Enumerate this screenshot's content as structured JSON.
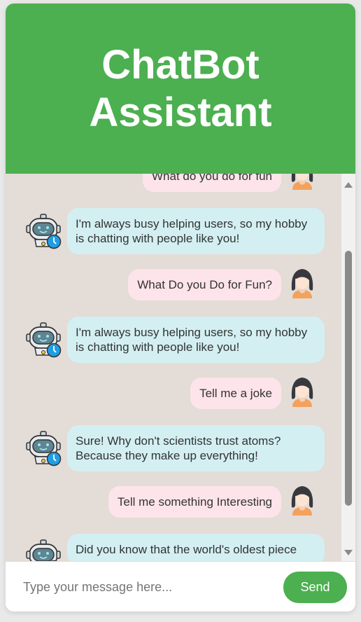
{
  "header": {
    "title": "ChatBot Assistant"
  },
  "messages": [
    {
      "sender": "user",
      "text": "What do you do for fun"
    },
    {
      "sender": "bot",
      "text": "I'm always busy helping users, so my hobby is chatting with people like you!"
    },
    {
      "sender": "user",
      "text": "What Do you Do for Fun?"
    },
    {
      "sender": "bot",
      "text": "I'm always busy helping users, so my hobby is chatting with people like you!"
    },
    {
      "sender": "user",
      "text": "Tell me a joke"
    },
    {
      "sender": "bot",
      "text": "Sure! Why don't scientists trust atoms? Because they make up everything!"
    },
    {
      "sender": "user",
      "text": "Tell me something Interesting"
    },
    {
      "sender": "bot",
      "text": "Did you know that the world's oldest piece"
    }
  ],
  "composer": {
    "placeholder": "Type your message here...",
    "value": "",
    "send_label": "Send"
  },
  "icons": {
    "user_avatar": "woman-avatar-icon",
    "bot_avatar": "robot-avatar-icon",
    "scroll_up": "scroll-up-arrow-icon",
    "scroll_down": "scroll-down-arrow-icon"
  },
  "colors": {
    "header": "#4caf50",
    "chat_background": "#e4dcd6",
    "user_bubble": "#fde4ea",
    "bot_bubble": "#d3eff2",
    "send_button": "#4caf50"
  }
}
